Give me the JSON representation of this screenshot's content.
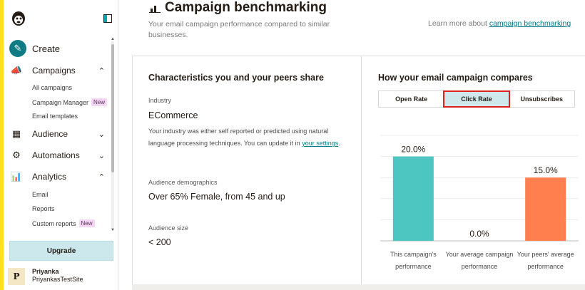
{
  "sidebar": {
    "create_label": "Create",
    "sections": [
      {
        "label": "Campaigns",
        "icon": "megaphone-icon",
        "expanded": true,
        "items": [
          {
            "label": "All campaigns",
            "badge": ""
          },
          {
            "label": "Campaign Manager",
            "badge": "New"
          },
          {
            "label": "Email templates",
            "badge": ""
          }
        ]
      },
      {
        "label": "Audience",
        "icon": "audience-icon",
        "expanded": false,
        "items": []
      },
      {
        "label": "Automations",
        "icon": "automations-icon",
        "expanded": false,
        "items": []
      },
      {
        "label": "Analytics",
        "icon": "analytics-icon",
        "expanded": true,
        "items": [
          {
            "label": "Email",
            "badge": ""
          },
          {
            "label": "Reports",
            "badge": ""
          },
          {
            "label": "Custom reports",
            "badge": "New"
          }
        ]
      }
    ],
    "upgrade_label": "Upgrade",
    "user": {
      "initial": "P",
      "name": "Priyanka",
      "site": "PriyankasTestSite"
    }
  },
  "header": {
    "title": "Campaign benchmarking",
    "subtitle": "Your email campaign performance compared to similar businesses.",
    "learn_prefix": "Learn more about",
    "learn_link": "campaign benchmarking"
  },
  "left": {
    "heading": "Characteristics you and your peers share",
    "industry_label": "Industry",
    "industry_value": "ECommerce",
    "industry_desc": "Your industry was either self reported or predicted using natural language processing techniques. You can update it in",
    "settings_link": "your settings",
    "demographics_label": "Audience demographics",
    "demographics_value": "Over 65% Female, from 45 and up",
    "size_label": "Audience size",
    "size_value": "< 200"
  },
  "right": {
    "heading": "How your email campaign compares",
    "tabs": [
      "Open Rate",
      "Click Rate",
      "Unsubscribes"
    ],
    "active_tab": "Click Rate"
  },
  "chart_data": {
    "type": "bar",
    "categories": [
      "This campaign's performance",
      "Your average campaign performance",
      "Your peers' average performance"
    ],
    "values": [
      20.0,
      0.0,
      15.0
    ],
    "data_labels": [
      "20.0%",
      "0.0%",
      "15.0%"
    ],
    "colors": [
      "#4dc5c0",
      "#4dc5c0",
      "#ff7f4f"
    ],
    "ylim": [
      0,
      25
    ],
    "grid": true
  }
}
